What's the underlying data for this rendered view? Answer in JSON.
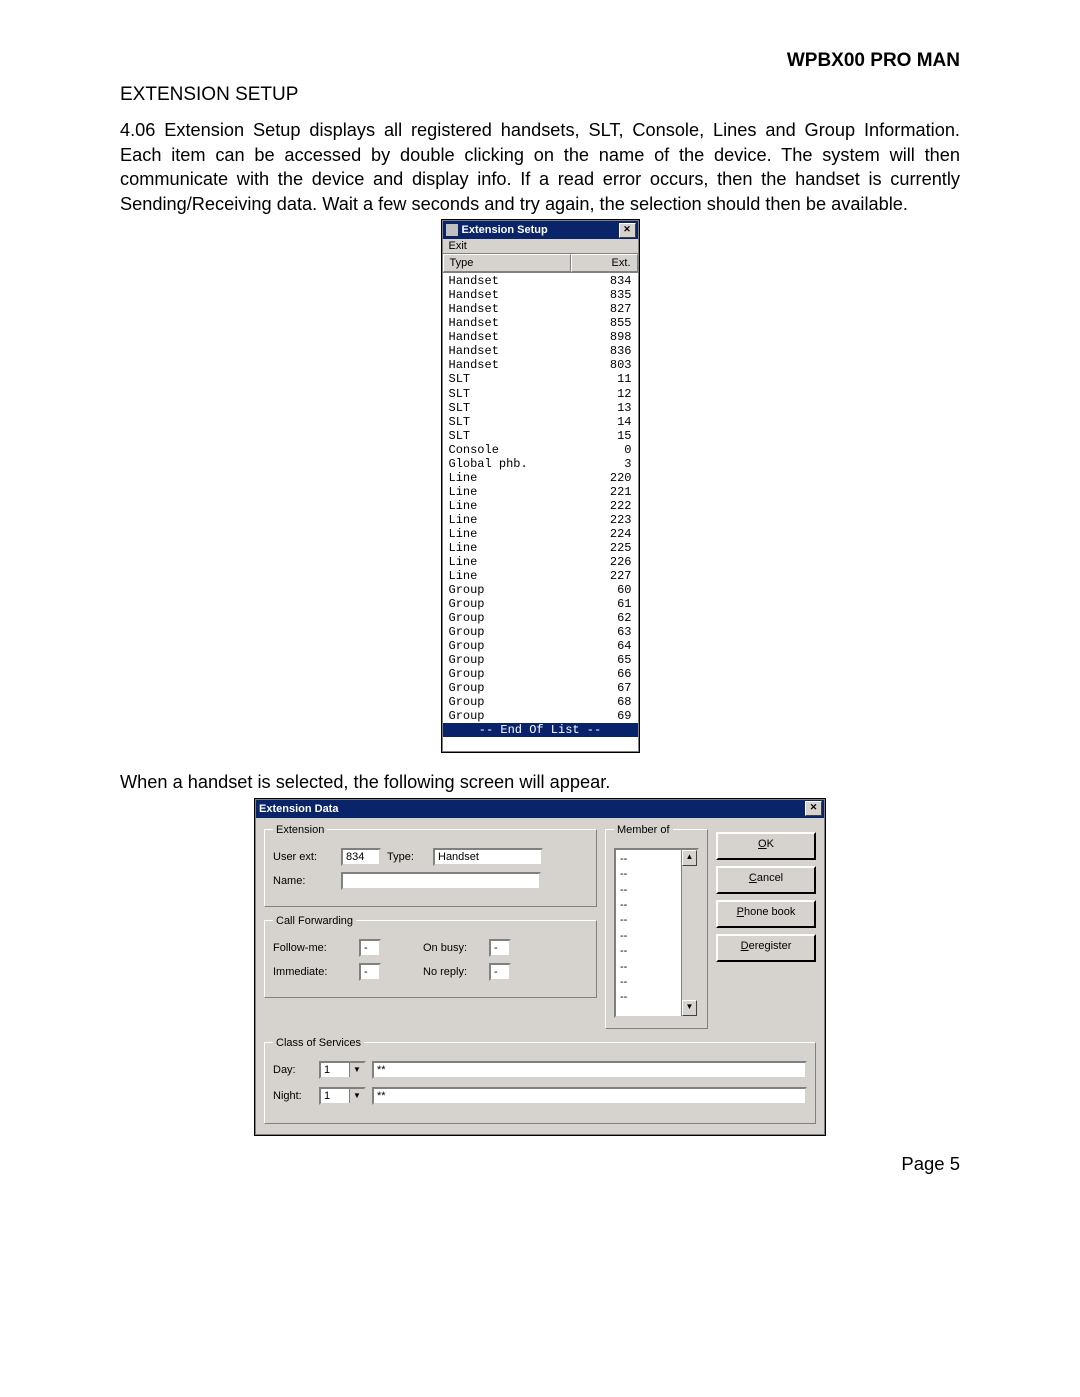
{
  "doc": {
    "title": "WPBX00 PRO MAN",
    "section_title": "EXTENSION SETUP",
    "paragraph_406": "4.06    Extension Setup displays all registered handsets, SLT, Console, Lines and Group Information.  Each item can be accessed by double clicking on the name of the device.  The system will then communicate with the device and display info. If a read error occurs, then the handset is currently Sending/Receiving data.  Wait a few seconds and try again, the selection should then be available.",
    "paragraph_after": "When a handset is selected, the following screen will appear.",
    "page_num": "Page 5"
  },
  "setup_window": {
    "title": "Extension Setup",
    "menu_exit": "Exit",
    "col_type": "Type",
    "col_ext": "Ext.",
    "rows": [
      {
        "type": "Handset",
        "ext": "834"
      },
      {
        "type": "Handset",
        "ext": "835"
      },
      {
        "type": "Handset",
        "ext": "827"
      },
      {
        "type": "Handset",
        "ext": "855"
      },
      {
        "type": "Handset",
        "ext": "898"
      },
      {
        "type": "Handset",
        "ext": "836"
      },
      {
        "type": "Handset",
        "ext": "803"
      },
      {
        "type": "SLT",
        "ext": "11"
      },
      {
        "type": "SLT",
        "ext": "12"
      },
      {
        "type": "SLT",
        "ext": "13"
      },
      {
        "type": "SLT",
        "ext": "14"
      },
      {
        "type": "SLT",
        "ext": "15"
      },
      {
        "type": "Console",
        "ext": "0"
      },
      {
        "type": "Global phb.",
        "ext": "3"
      },
      {
        "type": "Line",
        "ext": "220"
      },
      {
        "type": "Line",
        "ext": "221"
      },
      {
        "type": "Line",
        "ext": "222"
      },
      {
        "type": "Line",
        "ext": "223"
      },
      {
        "type": "Line",
        "ext": "224"
      },
      {
        "type": "Line",
        "ext": "225"
      },
      {
        "type": "Line",
        "ext": "226"
      },
      {
        "type": "Line",
        "ext": "227"
      },
      {
        "type": "Group",
        "ext": "60"
      },
      {
        "type": "Group",
        "ext": "61"
      },
      {
        "type": "Group",
        "ext": "62"
      },
      {
        "type": "Group",
        "ext": "63"
      },
      {
        "type": "Group",
        "ext": "64"
      },
      {
        "type": "Group",
        "ext": "65"
      },
      {
        "type": "Group",
        "ext": "66"
      },
      {
        "type": "Group",
        "ext": "67"
      },
      {
        "type": "Group",
        "ext": "68"
      },
      {
        "type": "Group",
        "ext": "69"
      }
    ],
    "end_of_list": "-- End Of List --"
  },
  "data_window": {
    "title": "Extension Data",
    "extension_legend": "Extension",
    "userext_label": "User ext:",
    "userext_value": "834",
    "type_label": "Type:",
    "type_value": "Handset",
    "name_label": "Name:",
    "name_value": "",
    "cf_legend": "Call Forwarding",
    "followme_label": "Follow-me:",
    "followme_value": "-",
    "onbusy_label": "On busy:",
    "onbusy_value": "-",
    "immediate_label": "Immediate:",
    "immediate_value": "-",
    "noreply_label": "No reply:",
    "noreply_value": "-",
    "memberof_legend": "Member of",
    "member_items": [
      "--",
      "--",
      "--",
      "--",
      "--",
      "--",
      "--",
      "--",
      "--",
      "--"
    ],
    "btn_ok_pre": "",
    "btn_ok_u": "O",
    "btn_ok_post": "K",
    "btn_cancel_pre": "",
    "btn_cancel_u": "C",
    "btn_cancel_post": "ancel",
    "btn_phonebook_pre": "",
    "btn_phonebook_u": "P",
    "btn_phonebook_post": "hone book",
    "btn_dereg_pre": "",
    "btn_dereg_u": "D",
    "btn_dereg_post": "eregister",
    "cos_legend": "Class of Services",
    "day_label": "Day:",
    "day_value": "1",
    "day_asterisks": "**",
    "night_label": "Night:",
    "night_value": "1",
    "night_asterisks": "**"
  }
}
